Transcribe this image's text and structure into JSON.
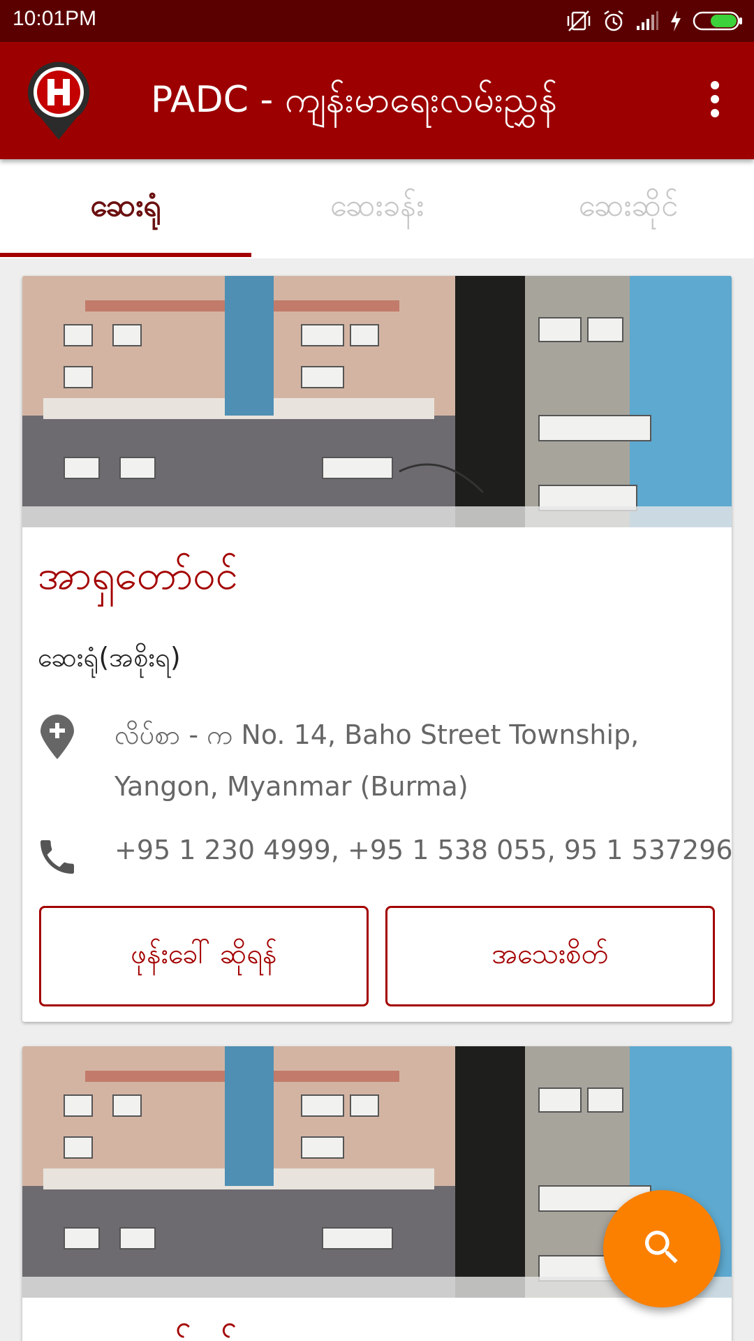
{
  "status_bar": {
    "time": "10:01PM",
    "icons": [
      "vibrate-off-icon",
      "alarm-icon",
      "signal-icon",
      "charging-icon",
      "battery-icon"
    ]
  },
  "app_bar": {
    "title": "PADC - ကျန်းမာရေးလမ်းညွှန်",
    "logo_icon": "hospital-pin-logo",
    "menu_icon": "more-vert-icon"
  },
  "tabs": [
    {
      "label": "ဆေးရုံ",
      "active": true
    },
    {
      "label": "ဆေးခန်း",
      "active": false
    },
    {
      "label": "ဆေးဆိုင်",
      "active": false
    }
  ],
  "cards": [
    {
      "name": "အာရှတော်ဝင်",
      "type": "ဆေးရုံ(အစိုးရ)",
      "address": "လိပ်စာ - က No. 14, Baho Street Township, Yangon, Myanmar (Burma)",
      "phone": "+95 1 230 4999, +95 1 538 055, 95 1 537296,",
      "call_label": "ဖုန်းခေါ် ဆိုရန်",
      "detail_label": "အသေးစိတ်"
    },
    {
      "name": "အာရှတော်ဝင်"
    }
  ],
  "fab": {
    "icon": "search-icon"
  },
  "colors": {
    "status_bar": "#5b0000",
    "primary": "#9c0000",
    "accent": "#fb8000",
    "active_tab_text": "#6a0f0f"
  }
}
